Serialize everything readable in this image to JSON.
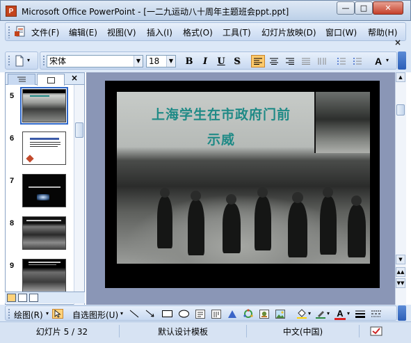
{
  "window": {
    "title": "Microsoft Office PowerPoint - [一二九运动八十周年主题班会ppt.ppt]",
    "app_icon_letter": "P",
    "minimize": "—",
    "maximize": "□",
    "close": "✕"
  },
  "menu": {
    "items": [
      {
        "label": "文件(F)"
      },
      {
        "label": "编辑(E)"
      },
      {
        "label": "视图(V)"
      },
      {
        "label": "插入(I)"
      },
      {
        "label": "格式(O)"
      },
      {
        "label": "工具(T)"
      },
      {
        "label": "幻灯片放映(D)"
      },
      {
        "label": "窗口(W)"
      },
      {
        "label": "帮助(H)"
      }
    ],
    "close_doc": "×"
  },
  "format_toolbar": {
    "font_name": "宋体",
    "font_size": "18",
    "bold": "B",
    "italic": "I",
    "underline": "U",
    "shadow": "S",
    "font_color_letter": "A"
  },
  "outline_pane": {
    "close": "×",
    "slides": [
      {
        "number": "5"
      },
      {
        "number": "6"
      },
      {
        "number": "7"
      },
      {
        "number": "8"
      },
      {
        "number": "9"
      }
    ],
    "selected_slide": "5"
  },
  "slide": {
    "title_line1": "上海学生在市政府门前",
    "title_line2": "示威",
    "title_color": "#1f8a86"
  },
  "drawing_toolbar": {
    "draw_label": "绘图(R)",
    "autoshapes_label": "自选图形(U)",
    "font_color_letter": "A"
  },
  "status": {
    "slide_position": "幻灯片 5 / 32",
    "design_template": "默认设计模板",
    "language": "中文(中国)"
  }
}
